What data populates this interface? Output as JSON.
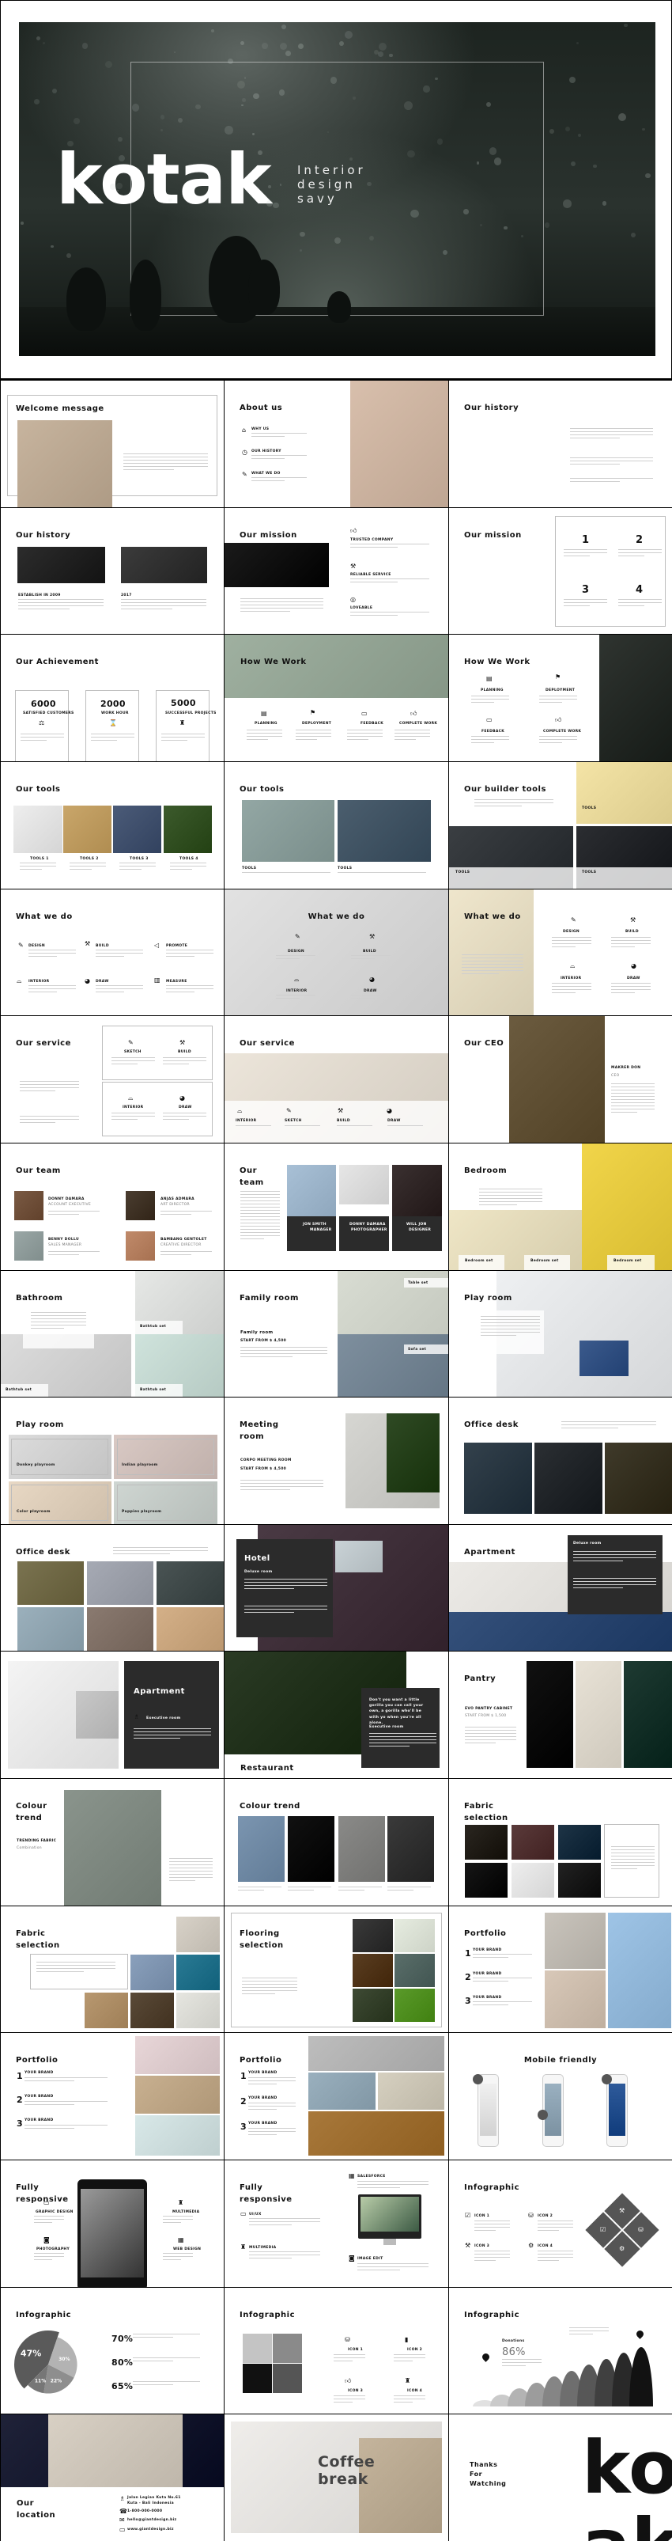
{
  "hero": {
    "title": "kotak",
    "subtitle": [
      "Interior",
      "design",
      "savy"
    ]
  },
  "slides": [
    {
      "title": "Welcome  message",
      "tones": [
        "#c7b49e",
        "#ece6de"
      ]
    },
    {
      "title": "About us",
      "labels": [
        "WHY US",
        "OUR HISTORY",
        "WHAT WE DO"
      ],
      "tones": [
        "#d8bfac",
        "#3c3c40"
      ]
    },
    {
      "title": "Our history"
    },
    {
      "title": "Our history",
      "labels": [
        "ESTABLISH IN 2009",
        "2017"
      ],
      "tones": [
        "#2c2c2c",
        "#3b3b3b"
      ]
    },
    {
      "title": "Our mission",
      "labels": [
        "TRUSTED COMPANY",
        "RELIABLE SERVICE",
        "LOVEABLE"
      ],
      "tones": [
        "#1a1a1a",
        "#9a9a9a"
      ]
    },
    {
      "title": "Our mission",
      "labels": [
        "1",
        "2",
        "3",
        "4"
      ]
    },
    {
      "title": "Our Achievement",
      "labels": [
        "6000",
        "SATISFIED CUSTOMERS",
        "2000",
        "WORK HOUR",
        "5000",
        "SUCCESSFUL PROJECTS"
      ]
    },
    {
      "title": "How We Work",
      "labels": [
        "PLANNING",
        "DEPLOYMENT",
        "FEEDBACK",
        "COMPLETE WORK"
      ],
      "tones": [
        "#9fb0a0",
        "#e9ece4"
      ]
    },
    {
      "title": "How We Work",
      "labels": [
        "PLANNING",
        "DEPLOYMENT",
        "FEEDBACK",
        "COMPLETE WORK"
      ],
      "tones": [
        "#2f3430",
        "#8c8f8b"
      ]
    },
    {
      "title": "Our tools",
      "labels": [
        "TOOLS 1",
        "TOOLS 2",
        "TOOLS 3",
        "TOOLS 4"
      ],
      "tones": [
        "#eeeeee",
        "#c9a66a",
        "#4b5b78",
        "#3c5a2c"
      ]
    },
    {
      "title": "Our tools",
      "labels": [
        "TOOLS",
        "TOOLS"
      ],
      "tones": [
        "#93a7a4",
        "#4b5e6e"
      ]
    },
    {
      "title": "Our builder tools",
      "labels": [
        "TOOLS",
        "TOOLS",
        "TOOLS"
      ],
      "tones": [
        "#f4e4a6",
        "#3a3e42",
        "#2b2d31"
      ]
    },
    {
      "title": "What we do",
      "labels": [
        "DESIGN",
        "BUILD",
        "PROMOTE",
        "INTERIOR",
        "DRAW",
        "MEASURE"
      ]
    },
    {
      "title": "What we do",
      "labels": [
        "DESIGN",
        "BUILD",
        "INTERIOR",
        "DRAW"
      ],
      "tones": [
        "#e2e2e2",
        "#f1f1f1"
      ]
    },
    {
      "title": "What we do",
      "labels": [
        "DESIGN",
        "BUILD",
        "INTERIOR",
        "DRAW"
      ],
      "tones": [
        "#efe6cc",
        "#b5ab98"
      ]
    },
    {
      "title": "Our service",
      "labels": [
        "SKETCH",
        "BUILD",
        "INTERIOR",
        "DRAW"
      ]
    },
    {
      "title": "Our service",
      "labels": [
        "INTERIOR",
        "SKETCH",
        "BUILD",
        "DRAW"
      ],
      "tones": [
        "#ece5da",
        "#d9cfbf"
      ]
    },
    {
      "title": "Our CEO",
      "labels": [
        "MAKRER DON",
        "CEO"
      ],
      "tones": [
        "#6b5b3f",
        "#2c2a28"
      ]
    },
    {
      "title": "Our team",
      "labels": [
        "DONNY DAMARA",
        "ACCOUNT EXECUTIVE",
        "ANJAS ADMARA",
        "ART DIRECTOR",
        "BENNY DOLLU",
        "SALES MANAGER",
        "BAMBANG GENTOLET",
        "CREATIVE DIRECTOR"
      ],
      "tones": [
        "#7a5a44",
        "#4a3d30",
        "#9aa7a6",
        "#c08a6a"
      ]
    },
    {
      "title": "Our\nteam",
      "labels": [
        "JON SMITH",
        "MANAGER",
        "DONNY DAMARA",
        "PHOTOGRAPHER",
        "WILL JON",
        "DESIGNER"
      ],
      "tones": [
        "#a8c0d6",
        "#e6e6e6",
        "#3a3030"
      ]
    },
    {
      "title": "Bedroom",
      "labels": [
        "Bedroom set",
        "Bedroom set",
        "Bedroom set"
      ],
      "tones": [
        "#f1d54a",
        "#efe6c6"
      ]
    },
    {
      "title": "Bathroom",
      "labels": [
        "Bathtub set",
        "Bathtub set",
        "Bathtub set"
      ],
      "tones": [
        "#e6e8e6",
        "#dcdcdc",
        "#cfe3dc"
      ]
    },
    {
      "title": "Family room",
      "labels": [
        "Family room",
        "START FROM $ 4,500",
        "Table set",
        "Sofa set"
      ],
      "tones": [
        "#d8dcd2",
        "#7e8f9e"
      ]
    },
    {
      "title": "Play room",
      "tones": [
        "#eef0f2",
        "#3b5a8c"
      ]
    },
    {
      "title": "Play room",
      "labels": [
        "Donkey playroom",
        "Indian playroom",
        "Color playroom",
        "Puppies playroom"
      ],
      "tones": [
        "#dcdcdc",
        "#d9c9c4",
        "#e8d8c4",
        "#cfd6d2"
      ]
    },
    {
      "title": "Meeting\nroom",
      "labels": [
        "CORPO MEETING ROOM",
        "START FROM $ 4,500"
      ],
      "tones": [
        "#d6d6d2",
        "#2f4a24"
      ]
    },
    {
      "title": "Office desk",
      "tones": [
        "#33414c",
        "#2b2f33",
        "#3f3a2a"
      ]
    },
    {
      "title": "Office desk",
      "tones": [
        "#7a7350",
        "#a6aab4",
        "#4a5454",
        "#9bb0bc",
        "#8a7a70",
        "#d4b088"
      ]
    },
    {
      "title": "Hotel",
      "labels": [
        "Deluxe room"
      ],
      "tones": [
        "#4a3a44",
        "#c9d2d6"
      ]
    },
    {
      "title": "Apartment",
      "labels": [
        "Deluxe room"
      ],
      "tones": [
        "#eceae6",
        "#34507a"
      ]
    },
    {
      "title": "Apartment",
      "labels": [
        "Executive room"
      ],
      "tones": [
        "#f4f4f4",
        "#c8c8c8"
      ]
    },
    {
      "title": "Restaurant",
      "labels": [
        "Don't you want a little gorilla you can call your own, a gorilla who'll be with yo when you're all alone.",
        "Executive room"
      ],
      "tones": [
        "#2a3a24",
        "#e8eee0"
      ]
    },
    {
      "title": "Pantry",
      "labels": [
        "EVO PANTRY CABINET",
        "START FROM $ 1,500"
      ],
      "tones": [
        "#111111",
        "#e8e2d6",
        "#1e3a32"
      ]
    },
    {
      "title": "Colour\ntrend",
      "labels": [
        "TRENDING FABRIC",
        "Combination"
      ],
      "tones": [
        "#8a948c",
        "#2e4a5a"
      ]
    },
    {
      "title": "Colour trend",
      "tones": [
        "#7b95b0",
        "#111111",
        "#8a8a88",
        "#3a3a3a"
      ]
    },
    {
      "title": "Fabric\nselection",
      "tones": [
        "#2a2620",
        "#5a3a3a",
        "#1e3446",
        "#161616",
        "#eeeeee",
        "#222222"
      ]
    },
    {
      "title": "Fabric\nselection",
      "tones": [
        "#d8d2c8",
        "#8aa0bc",
        "#2a7a94",
        "#b89870",
        "#5a4a38",
        "#e6e6e0"
      ]
    },
    {
      "title": "Flooring\nselection",
      "tones": [
        "#3a3a3a",
        "#e6ece0",
        "#5a3e22",
        "#5a6e6a",
        "#3e4a34",
        "#5a9a2a"
      ]
    },
    {
      "title": "Portfolio",
      "labels": [
        "1",
        "YOUR BRAND",
        "2",
        "YOUR BRAND",
        "3",
        "YOUR BRAND"
      ],
      "tones": [
        "#c9c4bc",
        "#d8c8b8",
        "#9ec4e6"
      ]
    },
    {
      "title": "Portfolio",
      "labels": [
        "1",
        "YOUR BRAND",
        "2",
        "YOUR BRAND",
        "3",
        "YOUR BRAND"
      ],
      "tones": [
        "#e8d6d8",
        "#c8b090",
        "#d8e8e8"
      ]
    },
    {
      "title": "Portfolio",
      "labels": [
        "1",
        "YOUR BRAND",
        "2",
        "YOUR BRAND",
        "3",
        "YOUR BRAND"
      ],
      "tones": [
        "#bdbdbd",
        "#9ab0be",
        "#d6d0c0",
        "#a8783a"
      ]
    },
    {
      "title": "Mobile friendly",
      "tones": [
        "#f0f0f0",
        "#9ab0c0",
        "#2e5a9a"
      ]
    },
    {
      "title": "Fully\nresponsive",
      "labels": [
        "GRAPHIC DESIGN",
        "MULTIMEDIA",
        "PHOTOGRAPHY",
        "WEB DESIGN"
      ],
      "tones": [
        "#8a8a8a",
        "#2a2a2a"
      ]
    },
    {
      "title": "Fully\nresponsive",
      "labels": [
        "SALESFORCE",
        "UI/UX",
        "MULTIMEDIA",
        "IMAGE EDIT"
      ],
      "tones": [
        "#9cb89c",
        "#e0e8d0"
      ]
    },
    {
      "title": "Infographic",
      "labels": [
        "ICON 1",
        "ICON 2",
        "ICON 3",
        "ICON 4"
      ],
      "tones": [
        "#555555"
      ]
    },
    {
      "title": "Infographic",
      "labels": [
        "70%",
        "80%",
        "65%"
      ],
      "chart_data": {
        "type": "pie",
        "values": [
          47,
          30,
          22,
          11
        ],
        "labels": [
          "47%",
          "30%",
          "22%",
          "11%"
        ],
        "colors": [
          "#5a5a5a",
          "#b3b3b3",
          "#8e8e8e",
          "#767676"
        ]
      }
    },
    {
      "title": "Infographic",
      "labels": [
        "ICON 1",
        "ICON 2",
        "ICON 3",
        "ICON 4"
      ],
      "colors": [
        "#c4c4c4",
        "#8a8a8a",
        "#111111",
        "#555555"
      ]
    },
    {
      "title": "Infographic",
      "labels": [
        "Donations",
        "86%"
      ]
    },
    {
      "title": "Our\nlocation",
      "labels": [
        "Jalan Legian Kuta No.61",
        "Kuta - Bali Indonesia",
        "1-800-000-0000",
        "hello@giantdesign.biz",
        "www.giantdesign.biz"
      ],
      "tones": [
        "#1f2238",
        "#d8d0c4"
      ]
    },
    {
      "title": "Coffee\nbreak",
      "tones": [
        "#efedea",
        "#c4b49c"
      ]
    },
    {
      "title": "Thanks\nFor\nWatching",
      "labels": [
        "kot",
        "ak"
      ]
    }
  ]
}
